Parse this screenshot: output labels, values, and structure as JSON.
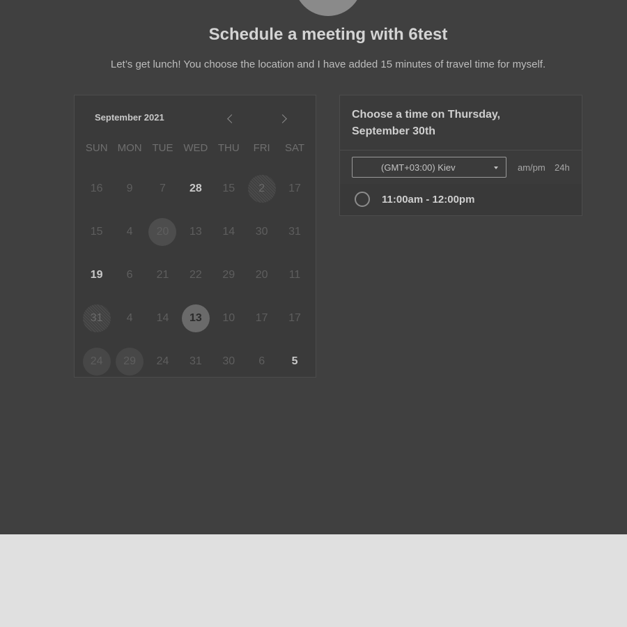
{
  "header": {
    "title": "Schedule a meeting with 6test",
    "subtitle": "Let’s get lunch! You choose the location and I have added 15 minutes of travel time for myself."
  },
  "calendar": {
    "month_label": "September 2021",
    "weekdays": [
      "SUN",
      "MON",
      "TUE",
      "WED",
      "THU",
      "FRI",
      "SAT"
    ],
    "weeks": [
      [
        "16",
        "9",
        "7",
        "28",
        "15",
        "2",
        "17"
      ],
      [
        "15",
        "4",
        "20",
        "13",
        "14",
        "30",
        "31"
      ],
      [
        "19",
        "6",
        "21",
        "22",
        "29",
        "20",
        "11"
      ],
      [
        "31",
        "4",
        "14",
        "13",
        "10",
        "17",
        "17"
      ],
      [
        "24",
        "29",
        "24",
        "31",
        "30",
        "6",
        "5"
      ]
    ]
  },
  "time_panel": {
    "heading": "Choose a time on Thursday, September 30th",
    "timezone": "(GMT+03:00) Kiev",
    "format_ampm": "am/pm",
    "format_24h": "24h",
    "slots": [
      {
        "label": "11:00am - 12:00pm"
      }
    ]
  }
}
